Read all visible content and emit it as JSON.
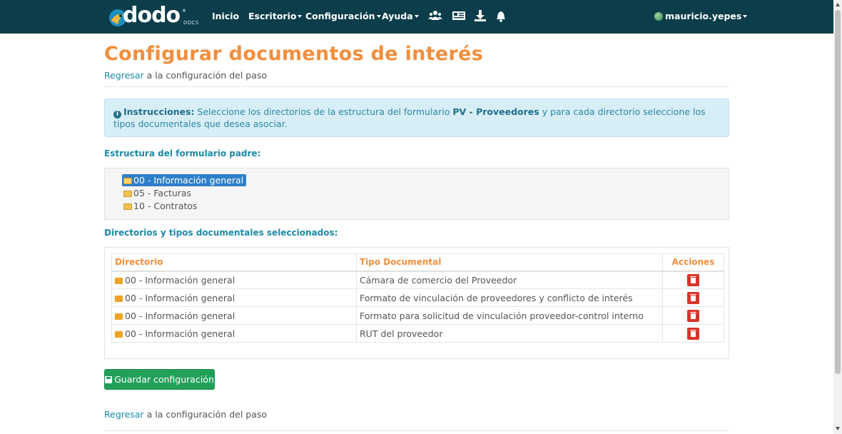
{
  "navbar": {
    "brand": {
      "word": "dodo",
      "reg": "®",
      "sub": "DOCS"
    },
    "items": [
      {
        "label": "Inicio",
        "dropdown": false
      },
      {
        "label": "Escritorio",
        "dropdown": true
      },
      {
        "label": "Configuración",
        "dropdown": true
      },
      {
        "label": "Ayuda",
        "dropdown": true
      }
    ],
    "icons": [
      "users-icon",
      "newspaper-icon",
      "download-icon",
      "bell-icon"
    ],
    "user": "mauricio.yepes"
  },
  "page": {
    "title": "Configurar documentos de interés",
    "back_link": "Regresar",
    "back_text": " a la configuración del paso"
  },
  "alert": {
    "label": "Instrucciones:",
    "text_before": " Seleccione los directorios de la estructura del formulario ",
    "form_name": "PV - Proveedores",
    "text_after": " y para cada directorio seleccione los tipos documentales que desea asociar."
  },
  "tree": {
    "label": "Estructura del formulario padre:",
    "nodes": [
      {
        "label": "00 - Información general",
        "selected": true
      },
      {
        "label": "05 - Facturas",
        "selected": false
      },
      {
        "label": "10 - Contratos",
        "selected": false
      }
    ]
  },
  "selected": {
    "label": "Directorios y tipos documentales seleccionados:",
    "headers": {
      "directorio": "Directorio",
      "tipo": "Tipo Documental",
      "acciones": "Acciones"
    },
    "rows": [
      {
        "directorio": "00 - Información general",
        "tipo": "Cámara de comercio del Proveedor"
      },
      {
        "directorio": "00 - Información general",
        "tipo": "Formato de vinculación de proveedores y conflicto de interés"
      },
      {
        "directorio": "00 - Información general",
        "tipo": "Formato para solicitud de vinculación proveedor-control interno"
      },
      {
        "directorio": "00 - Información general",
        "tipo": "RUT del proveedor"
      }
    ]
  },
  "actions": {
    "save_label": "Guardar configuración"
  },
  "colors": {
    "navbar": "#0b3d4b",
    "title": "#f08f3e",
    "link": "#1a8aa8",
    "save": "#22a05a",
    "delete": "#d9342b"
  }
}
